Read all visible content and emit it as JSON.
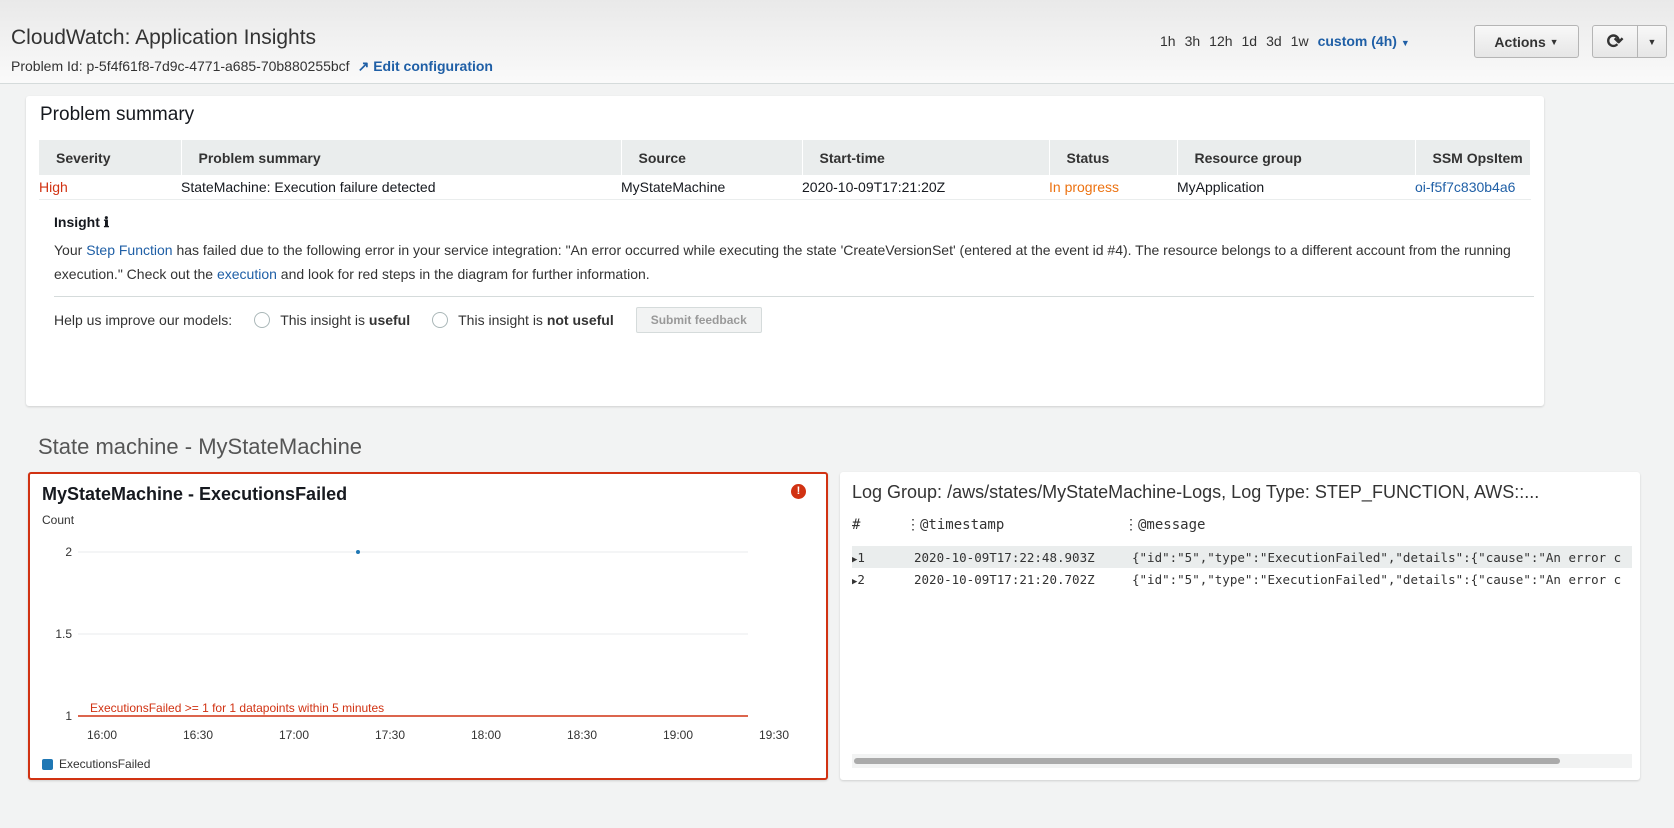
{
  "header": {
    "title": "CloudWatch: Application Insights",
    "problem_id": "Problem Id: p-5f4f61f8-7d9c-4771-a685-70b880255bcf",
    "edit": "Edit configuration",
    "ranges": [
      "1h",
      "3h",
      "12h",
      "1d",
      "3d",
      "1w"
    ],
    "range_selected": "custom (4h)",
    "actions": "Actions"
  },
  "summary": {
    "title": "Problem summary",
    "columns": [
      "Severity",
      "Problem summary",
      "Source",
      "Start-time",
      "Status",
      "Resource group",
      "SSM OpsItem"
    ],
    "row": [
      "High",
      "StateMachine: Execution failure detected",
      "MyStateMachine",
      "2020-10-09T17:21:20Z",
      "In progress",
      "MyApplication",
      "oi-f5f7c830b4a6"
    ],
    "insight_label": "Insight",
    "insight": {
      "p1": "Your ",
      "link1": "Step Function",
      "p2": " has failed due to the following error in your service integration: \"An error occurred while executing the state 'CreateVersionSet' (entered at the event id #4). The resource belongs to a different account from the running execution.\" Check out the ",
      "link2": "execution",
      "p3": " and look for red steps in the diagram for further information."
    },
    "feedback": {
      "label": "Help us improve our models:",
      "opt1_pre": "This insight is ",
      "opt1": "useful",
      "opt2_pre": "This insight is ",
      "opt2": "not useful",
      "submit": "Submit feedback"
    }
  },
  "section_title": "State machine - MyStateMachine",
  "chart_data": {
    "type": "line",
    "title": "MyStateMachine - ExecutionsFailed",
    "ylabel": "Count",
    "xlabel": "",
    "x_ticks": [
      "16:00",
      "16:30",
      "17:00",
      "17:30",
      "18:00",
      "18:30",
      "19:00",
      "19:30"
    ],
    "y_ticks": [
      "1",
      "1.5",
      "2"
    ],
    "ylim": [
      1,
      2
    ],
    "series": [
      {
        "name": "ExecutionsFailed",
        "color": "#1f77b4",
        "points": [
          {
            "x": "17:20",
            "y": 2
          }
        ]
      }
    ],
    "threshold": {
      "value": 1,
      "label": "ExecutionsFailed >= 1 for 1 datapoints within 5 minutes",
      "color": "#d13212"
    },
    "legend": "bottom-left",
    "grid": true
  },
  "logs": {
    "title": "Log Group: /aws/states/MyStateMachine-Logs, Log Type: STEP_FUNCTION, AWS::...",
    "columns": [
      "#",
      "@timestamp",
      "@message"
    ],
    "rows": [
      {
        "n": "1",
        "ts": "2020-10-09T17:22:48.903Z",
        "msg": "{\"id\":\"5\",\"type\":\"ExecutionFailed\",\"details\":{\"cause\":\"An error c"
      },
      {
        "n": "2",
        "ts": "2020-10-09T17:21:20.702Z",
        "msg": "{\"id\":\"5\",\"type\":\"ExecutionFailed\",\"details\":{\"cause\":\"An error c"
      }
    ]
  }
}
